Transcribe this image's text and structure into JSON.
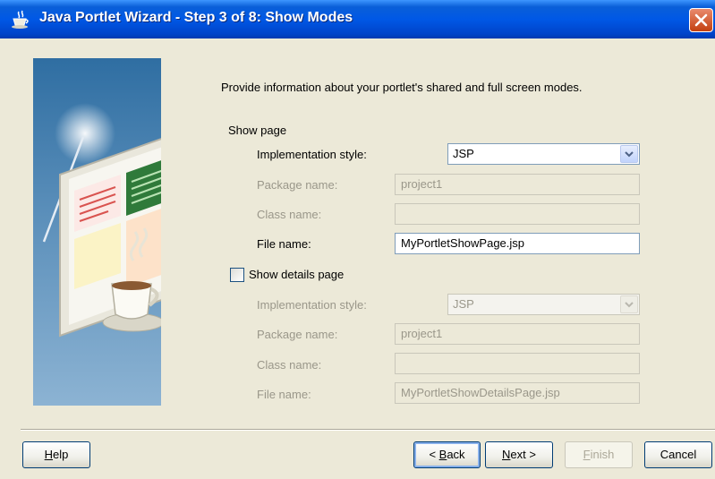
{
  "window": {
    "title": "Java Portlet Wizard - Step 3 of 8: Show Modes",
    "close_icon": "close-icon",
    "app_icon": "coffee-cup-icon"
  },
  "intro": "Provide information about your portlet's shared and full screen modes.",
  "show_page": {
    "heading": "Show page",
    "impl_label": "Implementation style:",
    "impl_value": "JSP",
    "package_label": "Package name:",
    "package_value": "project1",
    "class_label": "Class name:",
    "class_value": "",
    "file_label": "File name:",
    "file_value": "MyPortletShowPage.jsp"
  },
  "details_page": {
    "checkbox_label": "Show details page",
    "checked": false,
    "impl_label": "Implementation style:",
    "impl_value": "JSP",
    "package_label": "Package name:",
    "package_value": "project1",
    "class_label": "Class name:",
    "class_value": "",
    "file_label": "File name:",
    "file_value": "MyPortletShowDetailsPage.jsp"
  },
  "buttons": {
    "help": {
      "mnemonic": "H",
      "rest": "elp"
    },
    "back": {
      "prefix": "< ",
      "mnemonic": "B",
      "rest": "ack"
    },
    "next": {
      "mnemonic": "N",
      "rest": "ext >"
    },
    "finish": {
      "mnemonic": "F",
      "rest": "inish"
    },
    "cancel": "Cancel"
  },
  "colors": {
    "titlebar": "#0058e6",
    "dialog_bg": "#ece9d8",
    "field_border": "#7f9db9",
    "disabled_text": "#9a978a"
  }
}
